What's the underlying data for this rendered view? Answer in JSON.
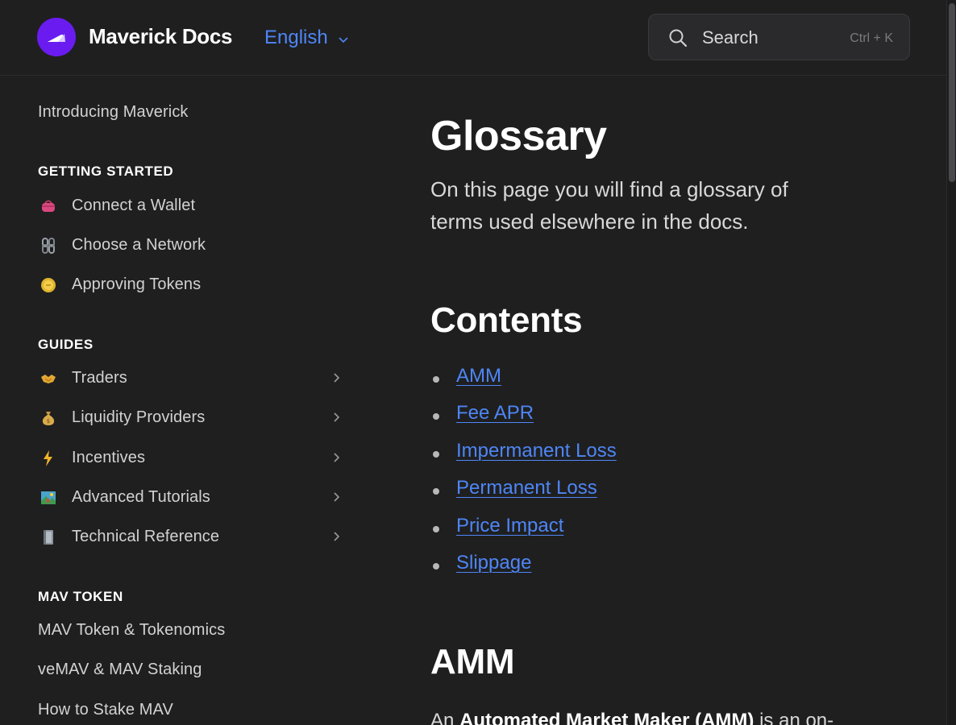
{
  "header": {
    "brand": "Maverick Docs",
    "language": "English",
    "search_placeholder": "Search",
    "search_shortcut": "Ctrl + K",
    "accent_color": "#4e86f5",
    "logo_color": "#6a1cf0"
  },
  "sidebar": {
    "intro_link": "Introducing Maverick",
    "getting_started": {
      "title": "GETTING STARTED",
      "items": [
        {
          "label": "Connect a Wallet",
          "icon": "purse-icon"
        },
        {
          "label": "Choose a Network",
          "icon": "chain-icon"
        },
        {
          "label": "Approving Tokens",
          "icon": "coin-icon"
        }
      ]
    },
    "guides": {
      "title": "GUIDES",
      "items": [
        {
          "label": "Traders",
          "icon": "handshake-icon"
        },
        {
          "label": "Liquidity Providers",
          "icon": "money-bag-icon"
        },
        {
          "label": "Incentives",
          "icon": "lightning-icon"
        },
        {
          "label": "Advanced Tutorials",
          "icon": "picture-icon"
        },
        {
          "label": "Technical Reference",
          "icon": "book-icon"
        }
      ]
    },
    "mav_token": {
      "title": "MAV TOKEN",
      "items": [
        "MAV Token & Tokenomics",
        "veMAV & MAV Staking",
        "How to Stake MAV"
      ]
    }
  },
  "main": {
    "title": "Glossary",
    "lead": "On this page you will find a glossary of terms used elsewhere in the docs.",
    "contents_heading": "Contents",
    "contents": [
      "AMM",
      "Fee APR",
      "Impermanent Loss",
      "Permanent Loss",
      "Price Impact",
      "Slippage"
    ],
    "amm_heading": "AMM",
    "amm_para_prefix": "An ",
    "amm_para_bold": "Automated Market Maker (AMM)",
    "amm_para_suffix": " is an on-"
  }
}
